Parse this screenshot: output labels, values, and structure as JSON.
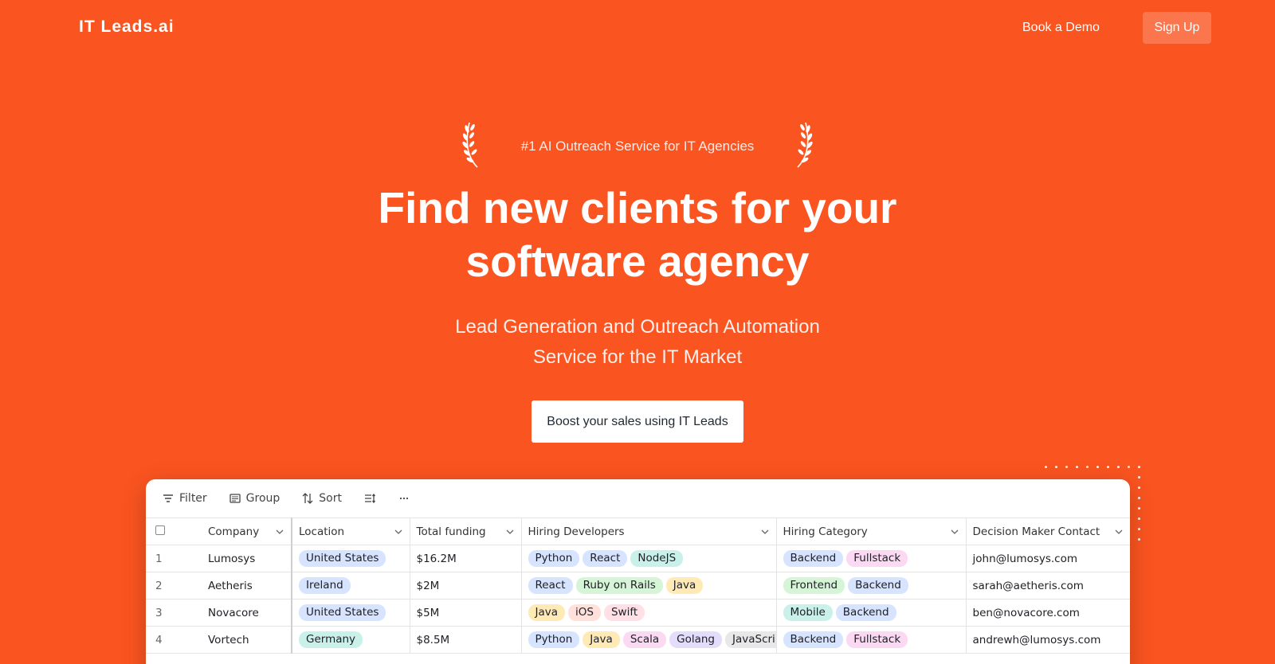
{
  "header": {
    "logo": "IT Leads.ai",
    "nav_demo": "Book a Demo",
    "nav_signup": "Sign Up"
  },
  "hero": {
    "award": "#1 AI Outreach Service for IT Agencies",
    "headline_line1": "Find new clients for your",
    "headline_line2": "software agency",
    "subhead_line1": "Lead Generation and Outreach Automation",
    "subhead_line2": "Service for the IT Market",
    "cta": "Boost your sales using IT Leads"
  },
  "toolbar": {
    "filter": "Filter",
    "group": "Group",
    "sort": "Sort"
  },
  "table": {
    "columns": [
      "Company",
      "Location",
      "Total funding",
      "Hiring Developers",
      "Hiring Category",
      "Decision Maker Contact"
    ],
    "rows": [
      {
        "idx": "1",
        "company": "Lumosys",
        "location": {
          "label": "United States",
          "color": "#d6e4ff"
        },
        "funding": "$16.2M",
        "devs": [
          {
            "label": "Python",
            "color": "#d6e4ff"
          },
          {
            "label": "React",
            "color": "#d6e4ff"
          },
          {
            "label": "NodeJS",
            "color": "#c9f1ea"
          }
        ],
        "categories": [
          {
            "label": "Backend",
            "color": "#d6e4ff"
          },
          {
            "label": "Fullstack",
            "color": "#fbd9f3"
          }
        ],
        "contact": "john@lumosys.com"
      },
      {
        "idx": "2",
        "company": "Aetheris",
        "location": {
          "label": "Ireland",
          "color": "#d6e4ff"
        },
        "funding": "$2M",
        "devs": [
          {
            "label": "React",
            "color": "#d6e4ff"
          },
          {
            "label": "Ruby on Rails",
            "color": "#d6f5d6"
          },
          {
            "label": "Java",
            "color": "#ffeab6"
          }
        ],
        "categories": [
          {
            "label": "Frontend",
            "color": "#d6f5d6"
          },
          {
            "label": "Backend",
            "color": "#d6e4ff"
          }
        ],
        "contact": "sarah@aetheris.com"
      },
      {
        "idx": "3",
        "company": "Novacore",
        "location": {
          "label": "United States",
          "color": "#d6e4ff"
        },
        "funding": "$5M",
        "devs": [
          {
            "label": "Java",
            "color": "#ffeab6"
          },
          {
            "label": "iOS",
            "color": "#ffe0db"
          },
          {
            "label": "Swift",
            "color": "#ffe0e6"
          }
        ],
        "categories": [
          {
            "label": "Mobile",
            "color": "#c9f1ea"
          },
          {
            "label": "Backend",
            "color": "#d6e4ff"
          }
        ],
        "contact": "ben@novacore.com"
      },
      {
        "idx": "4",
        "company": "Vortech",
        "location": {
          "label": "Germany",
          "color": "#c9f1ea"
        },
        "funding": "$8.5M",
        "devs": [
          {
            "label": "Python",
            "color": "#d6e4ff"
          },
          {
            "label": "Java",
            "color": "#ffeab6"
          },
          {
            "label": "Scala",
            "color": "#fbd9f3"
          },
          {
            "label": "Golang",
            "color": "#e3dcfb"
          },
          {
            "label": "JavaScript",
            "color": "#e8e8e8"
          }
        ],
        "categories": [
          {
            "label": "Backend",
            "color": "#d6e4ff"
          },
          {
            "label": "Fullstack",
            "color": "#fbd9f3"
          }
        ],
        "contact": "andrewh@lumosys.com"
      }
    ]
  },
  "colors": {
    "brand": "#fa5420",
    "cta_text": "#1f2933"
  }
}
